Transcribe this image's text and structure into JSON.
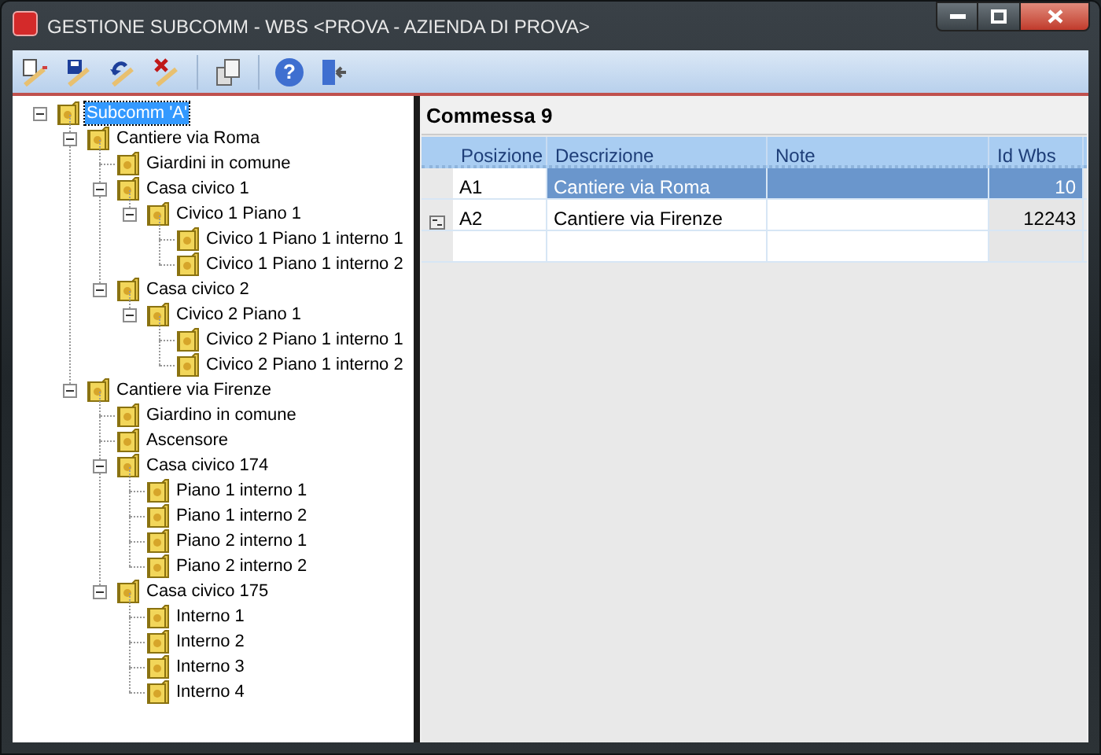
{
  "window": {
    "title": "GESTIONE SUBCOMM - WBS <PROVA - AZIENDA DI PROVA>"
  },
  "toolbar": [
    {
      "kind": "new"
    },
    {
      "kind": "save"
    },
    {
      "kind": "undo"
    },
    {
      "kind": "delete"
    },
    {
      "kind": "sep"
    },
    {
      "kind": "copy"
    },
    {
      "kind": "sep"
    },
    {
      "kind": "help",
      "label": "?"
    },
    {
      "kind": "exit"
    }
  ],
  "tree": [
    {
      "label": "Subcomm 'A'",
      "selected": true,
      "expanded": true,
      "children": [
        {
          "label": "Cantiere via Roma",
          "selected": false,
          "expanded": true,
          "children": [
            {
              "label": "Giardini in comune",
              "selected": false
            },
            {
              "label": "Casa civico 1",
              "selected": false,
              "expanded": true,
              "children": [
                {
                  "label": "Civico 1 Piano 1",
                  "selected": false,
                  "expanded": true,
                  "children": [
                    {
                      "label": "Civico 1 Piano 1 interno 1",
                      "selected": false
                    },
                    {
                      "label": "Civico 1 Piano 1 interno 2",
                      "selected": false
                    }
                  ]
                }
              ]
            },
            {
              "label": "Casa civico 2",
              "selected": false,
              "expanded": true,
              "children": [
                {
                  "label": "Civico 2 Piano 1",
                  "selected": false,
                  "expanded": true,
                  "children": [
                    {
                      "label": "Civico 2 Piano 1 interno 1",
                      "selected": false
                    },
                    {
                      "label": "Civico 2 Piano 1 interno 2",
                      "selected": false
                    }
                  ]
                }
              ]
            }
          ]
        },
        {
          "label": "Cantiere via Firenze",
          "selected": false,
          "expanded": true,
          "children": [
            {
              "label": "Giardino in comune",
              "selected": false
            },
            {
              "label": "Ascensore",
              "selected": false
            },
            {
              "label": "Casa civico 174",
              "selected": false,
              "expanded": true,
              "children": [
                {
                  "label": "Piano 1 interno 1",
                  "selected": false
                },
                {
                  "label": "Piano 1 interno 2",
                  "selected": false
                },
                {
                  "label": "Piano 2 interno 1",
                  "selected": false
                },
                {
                  "label": "Piano 2 interno 2",
                  "selected": false
                }
              ]
            },
            {
              "label": "Casa civico 175",
              "selected": false,
              "expanded": true,
              "children": [
                {
                  "label": "Interno 1",
                  "selected": false
                },
                {
                  "label": "Interno 2",
                  "selected": false
                },
                {
                  "label": "Interno 3",
                  "selected": false
                },
                {
                  "label": "Interno 4",
                  "selected": false
                }
              ]
            }
          ]
        }
      ]
    }
  ],
  "panel": {
    "title": "Commessa 9"
  },
  "table": {
    "columns": [
      "Posizione",
      "Descrizione",
      "Note",
      "Id Wbs"
    ],
    "rows": [
      {
        "cells": [
          "A1",
          "Cantiere via Roma",
          "",
          "10"
        ],
        "selected": true,
        "indicator": false
      },
      {
        "cells": [
          "A2",
          "Cantiere via Firenze",
          "",
          "12243"
        ],
        "selected": false,
        "indicator": true
      }
    ]
  }
}
